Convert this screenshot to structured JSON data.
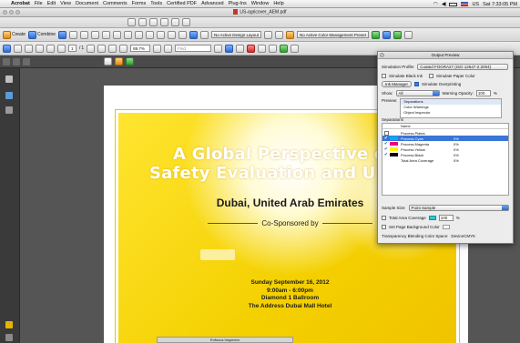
{
  "menubar": {
    "app": "Acrobat",
    "items": [
      "File",
      "Edit",
      "View",
      "Document",
      "Comments",
      "Forms",
      "Tools",
      "Certified PDF",
      "Advanced",
      "Plug-Ins",
      "Window",
      "Help"
    ],
    "clock": "Sat 7:33:05 PM",
    "flag_label": "US"
  },
  "window": {
    "title": "US-agricover_AEM.pdf"
  },
  "toolbar2": {
    "create_label": "Create",
    "combine_label": "Combine",
    "layout_label": "No Active Design Layout",
    "color_mgmt_label": "No Active Color Management Preset"
  },
  "toolbar3": {
    "page_current": "1",
    "page_total": "1",
    "zoom": "89.7%",
    "find_placeholder": "Find"
  },
  "poster": {
    "title_line1": "A Global Perspective o",
    "title_line2": "Safety Evaluation and U",
    "location": "Dubai, United Arab Emirates",
    "cosponsored": "Co-Sponsored by",
    "date_line1": "Sunday September 16, 2012",
    "date_line2": "9:00am - 6:00pm",
    "date_line3": "Diamond 1 Ballroom",
    "date_line4": "The Address Dubai Mall Hotel"
  },
  "bottom_label": "Enfocus Inspector",
  "output_preview": {
    "title": "Output Preview",
    "simulation_profile_label": "Simulation Profile:",
    "simulation_profile_value": "Coated FOGRA27 (ISO 12647-2:2004)",
    "simulate_black_ink": "Simulate Black Ink",
    "simulate_paper_color": "Simulate Paper Color",
    "ink_manager": "Ink Manager",
    "simulate_overprinting": "Simulate Overprinting",
    "show_label": "Show:",
    "show_value": "All",
    "warning_opacity_label": "Warning Opacity:",
    "warning_opacity_value": "100",
    "warning_opacity_unit": "%",
    "preview_label": "Preview:",
    "preview_options": [
      "Separations",
      "Color Warnings",
      "Object Inspector"
    ],
    "separations_label": "Separations",
    "name_header": "Name",
    "separations": [
      {
        "name": "Process Plates",
        "value": "",
        "swatch": "",
        "checked": false
      },
      {
        "name": "Process Cyan",
        "value": "0%",
        "swatch": "#00aeef",
        "checked": true
      },
      {
        "name": "Process Magenta",
        "value": "0%",
        "swatch": "#ec008c",
        "checked": true
      },
      {
        "name": "Process Yellow",
        "value": "0%",
        "swatch": "#fff200",
        "checked": true
      },
      {
        "name": "Process Black",
        "value": "0%",
        "swatch": "#000000",
        "checked": true
      },
      {
        "name": "Total Area Coverage",
        "value": "0%",
        "swatch": "",
        "checked": false
      }
    ],
    "sample_size_label": "Sample Size:",
    "sample_size_value": "Point Sample",
    "total_area_coverage": "Total Area Coverage",
    "tac_value": "100",
    "tac_unit": "%",
    "page_bg_color": "Set Page Background Color",
    "blending_label": "Transparency Blending Color Space:",
    "blending_value": "DeviceCMYK"
  },
  "colors": {
    "poster_yellow": "#f4d000",
    "selection_blue": "#3875d7"
  }
}
